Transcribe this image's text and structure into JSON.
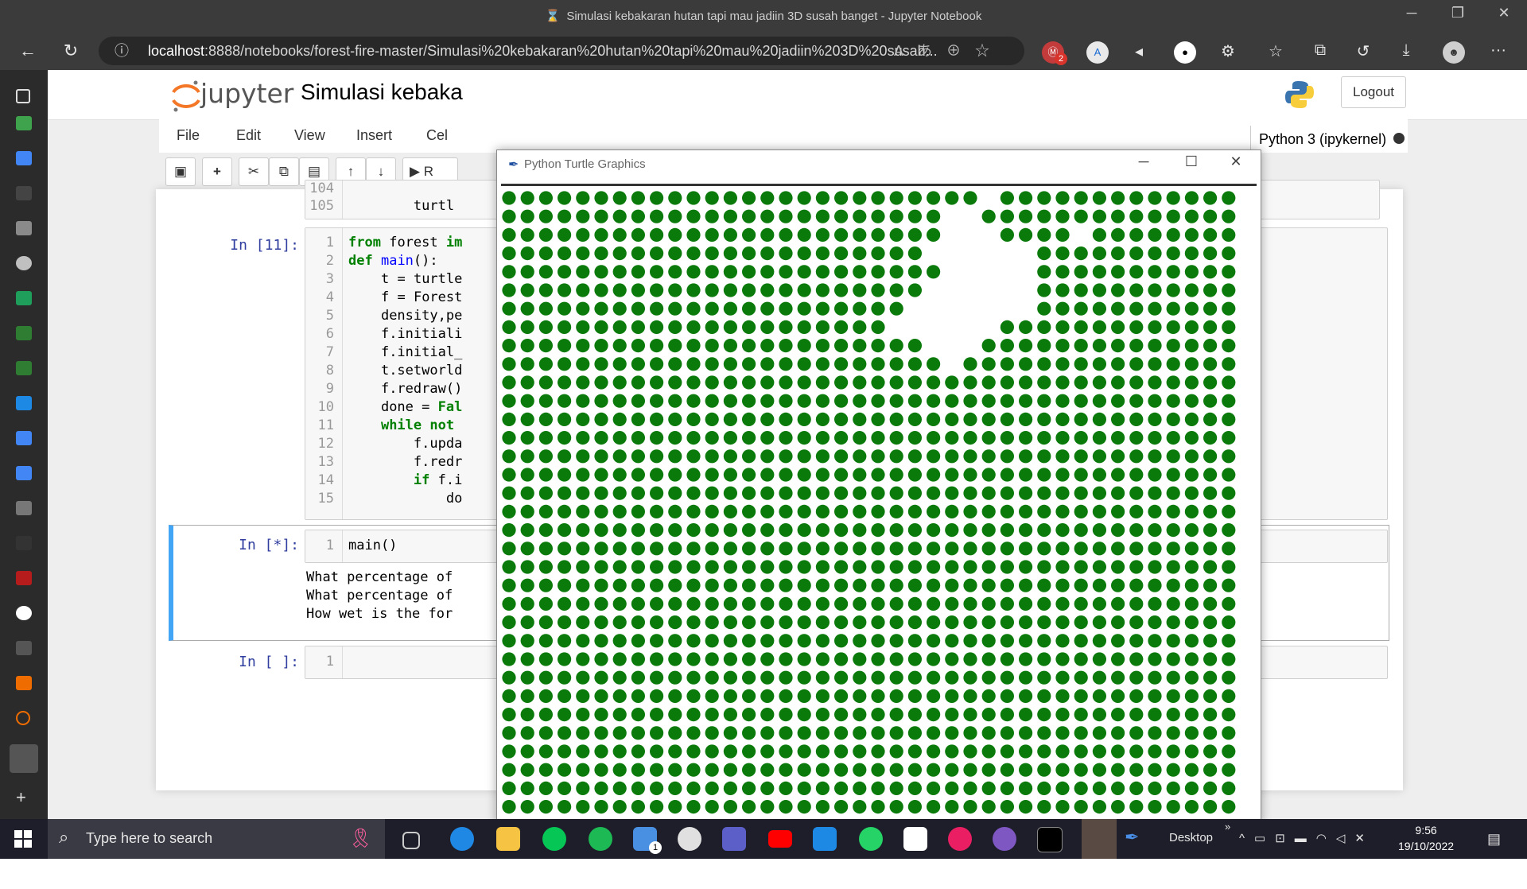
{
  "window": {
    "title": "Simulasi kebakaran hutan tapi mau jadiin 3D susah banget - Jupyter Notebook",
    "minimize": "─",
    "maximize": "❐",
    "close": "✕"
  },
  "browser": {
    "url_host": "localhost",
    "url_rest": ":8888/notebooks/forest-fire-master/Simulasi%20kebakaran%20hutan%20tapi%20mau%20jadiin%203D%20susah...",
    "more": "···"
  },
  "extensions": {
    "badge_count": "2"
  },
  "jupyter": {
    "logo_text": "jupyter",
    "notebook_title": "Simulasi kebaka",
    "logout": "Logout",
    "kernel": "Python 3 (ipykernel)",
    "menus": [
      "File",
      "Edit",
      "View",
      "Insert",
      "Cel"
    ],
    "run_label": "R"
  },
  "cells": {
    "prev": {
      "lines": [
        {
          "n": "104",
          "code": ""
        },
        {
          "n": "105",
          "code": "        turtl"
        }
      ]
    },
    "cell11": {
      "prompt": "In [11]:",
      "lines": [
        {
          "n": "1",
          "code": "from forest im"
        },
        {
          "n": "2",
          "code": "def main():"
        },
        {
          "n": "3",
          "code": "    t = turtle"
        },
        {
          "n": "4",
          "code": "    f = Forest"
        },
        {
          "n": "5",
          "code": "    density,pe"
        },
        {
          "n": "6",
          "code": "    f.initiali"
        },
        {
          "n": "7",
          "code": "    f.initial_"
        },
        {
          "n": "8",
          "code": "    t.setworld"
        },
        {
          "n": "9",
          "code": "    f.redraw()"
        },
        {
          "n": "10",
          "code": "    done = Fal"
        },
        {
          "n": "11",
          "code": "    while not "
        },
        {
          "n": "12",
          "code": "        f.upda"
        },
        {
          "n": "13",
          "code": "        f.redr"
        },
        {
          "n": "14",
          "code": "        if f.i"
        },
        {
          "n": "15",
          "code": "            do"
        }
      ]
    },
    "running": {
      "prompt": "In [*]:",
      "line_n": "1",
      "code": "main()",
      "output": [
        "What percentage of",
        "What percentage of",
        "How wet is the for"
      ]
    },
    "empty": {
      "prompt": "In [ ]:",
      "line_n": "1"
    }
  },
  "turtle_window": {
    "title": "Python Turtle Graphics",
    "tree_color": "#0a7a0a",
    "background": "#ffffff",
    "grid_cols": 40,
    "grid_rows": 34,
    "burnt_cells": [
      [
        1,
        24
      ],
      [
        1,
        25
      ],
      [
        2,
        24
      ],
      [
        2,
        25
      ],
      [
        2,
        26
      ],
      [
        3,
        23
      ],
      [
        3,
        24
      ],
      [
        3,
        25
      ],
      [
        3,
        26
      ],
      [
        3,
        27
      ],
      [
        3,
        28
      ],
      [
        4,
        24
      ],
      [
        4,
        25
      ],
      [
        4,
        26
      ],
      [
        4,
        27
      ],
      [
        4,
        28
      ],
      [
        5,
        23
      ],
      [
        5,
        24
      ],
      [
        5,
        25
      ],
      [
        5,
        26
      ],
      [
        5,
        27
      ],
      [
        5,
        28
      ],
      [
        6,
        22
      ],
      [
        6,
        23
      ],
      [
        6,
        24
      ],
      [
        6,
        25
      ],
      [
        6,
        26
      ],
      [
        6,
        27
      ],
      [
        6,
        28
      ],
      [
        7,
        21
      ],
      [
        7,
        22
      ],
      [
        7,
        23
      ],
      [
        7,
        24
      ],
      [
        7,
        25
      ],
      [
        7,
        26
      ],
      [
        8,
        23
      ],
      [
        8,
        24
      ],
      [
        8,
        25
      ],
      [
        2,
        31
      ],
      [
        9,
        24
      ],
      [
        0,
        26
      ]
    ]
  },
  "taskbar": {
    "search_placeholder": "Type here to search",
    "desktop_label": "Desktop",
    "mail_badge": "1",
    "time": "9:56",
    "date": "19/10/2022"
  }
}
